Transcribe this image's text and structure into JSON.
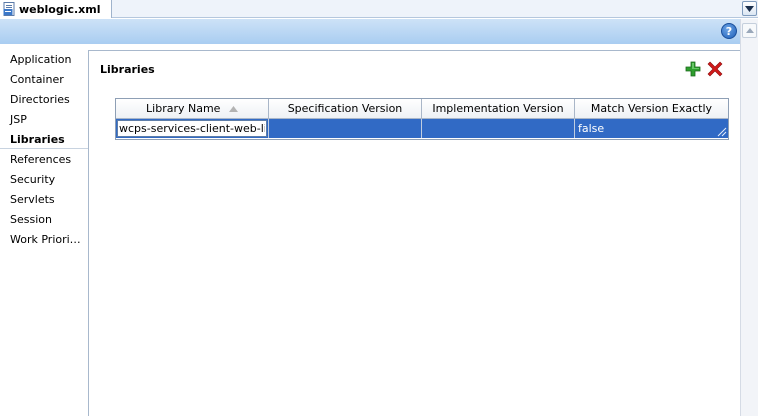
{
  "editor_tab": {
    "label": "weblogic.xml",
    "icon": "xml-file-icon"
  },
  "header": {
    "help_symbol": "?",
    "help_icon": "help-icon"
  },
  "nav": {
    "items": [
      {
        "label": "Application"
      },
      {
        "label": "Container"
      },
      {
        "label": "Directories"
      },
      {
        "label": "JSP"
      },
      {
        "label": "Libraries",
        "selected": true
      },
      {
        "label": "References"
      },
      {
        "label": "Security"
      },
      {
        "label": "Servlets"
      },
      {
        "label": "Session"
      },
      {
        "label": "Work Priori…"
      }
    ]
  },
  "panel": {
    "title": "Libraries",
    "add_icon": "add-icon",
    "remove_icon": "remove-icon"
  },
  "table": {
    "columns": [
      {
        "label": "Library Name",
        "sorted": "ascending"
      },
      {
        "label": "Specification Version"
      },
      {
        "label": "Implementation Version"
      },
      {
        "label": "Match Version Exactly"
      }
    ],
    "rows": [
      {
        "library_name": "wcps-services-client-web-lib",
        "specification_version": "",
        "implementation_version": "",
        "match_version_exactly": "false",
        "selected": true
      }
    ]
  },
  "colors": {
    "selection": "#316ac5",
    "header_band_top": "#cde2f7",
    "header_band_bottom": "#a9cdf1",
    "add_green": "#2e9e2e",
    "remove_red": "#d11a1a"
  }
}
